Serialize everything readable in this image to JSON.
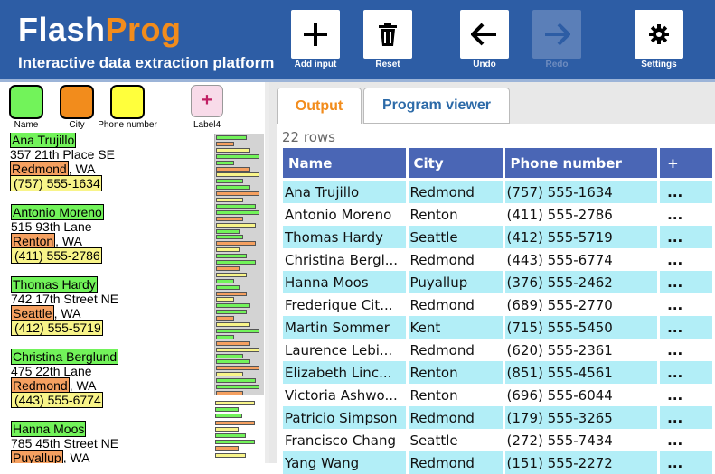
{
  "app": {
    "name_part1": "Flash",
    "name_part2": "Prog",
    "tagline": "Interactive data extraction platform"
  },
  "toolbar": {
    "add_input": "Add input",
    "reset": "Reset",
    "undo": "Undo",
    "redo": "Redo",
    "settings": "Settings",
    "redo_disabled": true
  },
  "labels": {
    "name": "Name",
    "city": "City",
    "phone": "Phone number",
    "label4": "Label4",
    "label4_plus": "+"
  },
  "colors": {
    "name": "#72f35a",
    "city": "#f5a060",
    "phone": "#f8f489",
    "header_blue": "#2d5da5",
    "brand_orange": "#f28c1c",
    "table_header": "#4a66b5",
    "row_alt": "#b2eef7"
  },
  "records": [
    {
      "name": "Ana Trujillo",
      "street": "357 21th Place SE",
      "city": "Redmond",
      "state": ", WA",
      "phone": "(757) 555-1634"
    },
    {
      "name": "Antonio Moreno",
      "street": "515 93th Lane",
      "city": "Renton",
      "state": ", WA",
      "phone": "(411) 555-2786"
    },
    {
      "name": "Thomas Hardy",
      "street": "742 17th Street NE",
      "city": "Seattle",
      "state": ", WA",
      "phone": "(412) 555-5719"
    },
    {
      "name": "Christina Berglund",
      "street": "475 22th Lane",
      "city": "Redmond",
      "state": ", WA",
      "phone": "(443) 555-6774"
    },
    {
      "name": "Hanna Moos",
      "street": "785 45th Street NE",
      "city": "Puyallup",
      "state": ", WA",
      "phone": ""
    }
  ],
  "tabs": {
    "output": "Output",
    "program_viewer": "Program viewer"
  },
  "output": {
    "row_count": "22 rows",
    "columns": [
      "Name",
      "City",
      "Phone number",
      "+"
    ],
    "rows": [
      [
        "Ana Trujillo",
        "Redmond",
        "(757) 555-1634",
        "..."
      ],
      [
        "Antonio Moreno",
        "Renton",
        "(411) 555-2786",
        "..."
      ],
      [
        "Thomas Hardy",
        "Seattle",
        "(412) 555-5719",
        "..."
      ],
      [
        "Christina Bergl...",
        "Redmond",
        "(443) 555-6774",
        "..."
      ],
      [
        "Hanna Moos",
        "Puyallup",
        "(376) 555-2462",
        "..."
      ],
      [
        "Frederique Cit...",
        "Redmond",
        "(689) 555-2770",
        "..."
      ],
      [
        "Martin Sommer",
        "Kent",
        "(715) 555-5450",
        "..."
      ],
      [
        "Laurence Lebi...",
        "Redmond",
        "(620) 555-2361",
        "..."
      ],
      [
        "Elizabeth Linc...",
        "Renton",
        "(851) 555-4561",
        "..."
      ],
      [
        "Victoria Ashwo...",
        "Renton",
        "(696) 555-6044",
        "..."
      ],
      [
        "Patricio Simpson",
        "Redmond",
        "(179) 555-3265",
        "..."
      ],
      [
        "Francisco Chang",
        "Seattle",
        "(272) 555-7434",
        "..."
      ],
      [
        "Yang Wang",
        "Redmond",
        "(151) 555-2272",
        "..."
      ]
    ]
  }
}
